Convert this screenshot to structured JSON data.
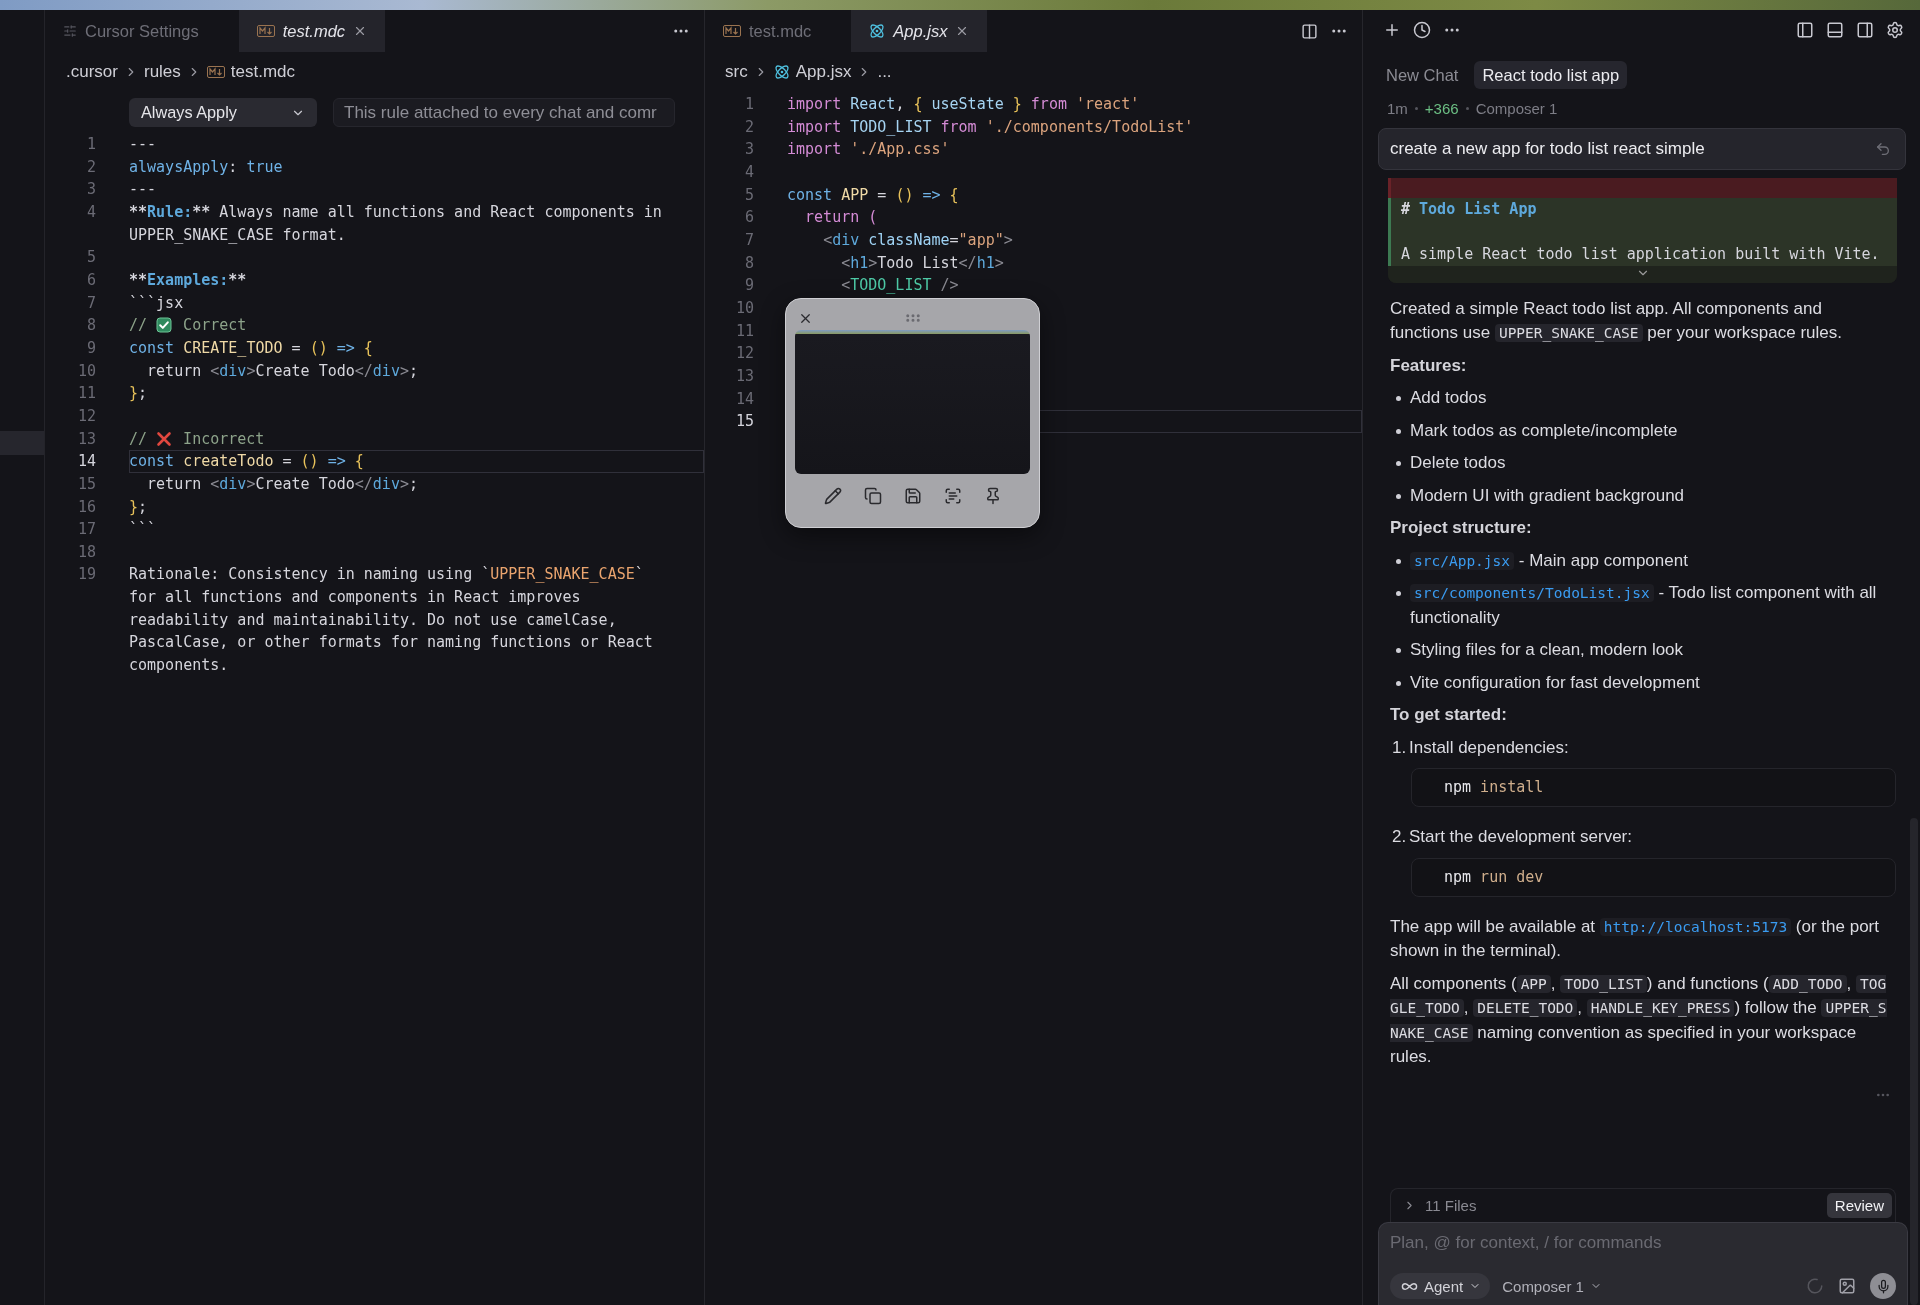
{
  "left_editor": {
    "tabs": [
      {
        "label": "Cursor Settings",
        "kind": "settings",
        "selected": false,
        "preview": false
      },
      {
        "label": "test.mdc",
        "kind": "markdown",
        "selected": true,
        "preview": true
      }
    ],
    "breadcrumb": [
      {
        "kind": "plain",
        "label": ".cursor"
      },
      {
        "kind": "plain",
        "label": "rules"
      },
      {
        "kind": "markdown",
        "label": "test.mdc"
      }
    ],
    "rule_type": {
      "value": "Always Apply"
    },
    "description": {
      "value": "This rule attached to every chat and comr"
    },
    "lines": [
      {
        "number": "1",
        "current": false,
        "tokens": [
          {
            "kind": "plain",
            "text": "---"
          }
        ]
      },
      {
        "number": "2",
        "current": false,
        "tokens": [
          {
            "kind": "key",
            "text": "alwaysApply"
          },
          {
            "kind": "plain",
            "text": ": "
          },
          {
            "kind": "key",
            "text": "true"
          }
        ]
      },
      {
        "number": "3",
        "current": false,
        "tokens": [
          {
            "kind": "plain",
            "text": "---"
          }
        ]
      },
      {
        "number": "4",
        "current": false,
        "tokens": [
          {
            "kind": "strong",
            "text": "**"
          },
          {
            "kind": "heading",
            "text": "Rule:"
          },
          {
            "kind": "strong",
            "text": "**"
          },
          {
            "kind": "plain",
            "text": " Always name all functions and React components in UPPER_SNAKE_CASE format."
          }
        ]
      },
      {
        "number": "5",
        "current": false
      },
      {
        "number": "6",
        "current": false,
        "tokens": [
          {
            "kind": "strong",
            "text": "**"
          },
          {
            "kind": "heading",
            "text": "Examples:"
          },
          {
            "kind": "strong",
            "text": "**"
          }
        ]
      },
      {
        "number": "7",
        "current": false,
        "tokens": [
          {
            "kind": "plain",
            "text": "```jsx"
          }
        ]
      },
      {
        "number": "8",
        "current": false,
        "tokens": [
          {
            "kind": "comment",
            "text": "// "
          },
          {
            "kind": "check-emoji"
          },
          {
            "kind": "comment",
            "text": " Correct"
          }
        ]
      },
      {
        "number": "9",
        "current": false,
        "tokens": [
          {
            "kind": "keyword",
            "text": "const"
          },
          {
            "kind": "function",
            "text": " CREATE_TODO"
          },
          {
            "kind": "plain",
            "text": " = "
          },
          {
            "kind": "bracket",
            "text": "()"
          },
          {
            "kind": "operator",
            "text": " =>"
          },
          {
            "kind": "bracket",
            "text": " {"
          }
        ]
      },
      {
        "number": "10",
        "current": false,
        "tokens": [
          {
            "kind": "plain",
            "text": "  return "
          },
          {
            "kind": "tagpunct",
            "text": "<"
          },
          {
            "kind": "tag",
            "text": "div"
          },
          {
            "kind": "tagpunct",
            "text": ">"
          },
          {
            "kind": "plain",
            "text": "Create Todo"
          },
          {
            "kind": "tagpunct",
            "text": "</"
          },
          {
            "kind": "tag",
            "text": "div"
          },
          {
            "kind": "tagpunct",
            "text": ">"
          },
          {
            "kind": "plain",
            "text": ";"
          }
        ]
      },
      {
        "number": "11",
        "current": false,
        "tokens": [
          {
            "kind": "bracket",
            "text": "}"
          },
          {
            "kind": "plain",
            "text": ";"
          }
        ]
      },
      {
        "number": "12",
        "current": false
      },
      {
        "number": "13",
        "current": false,
        "tokens": [
          {
            "kind": "comment",
            "text": "// "
          },
          {
            "kind": "cross-emoji"
          },
          {
            "kind": "comment",
            "text": " Incorrect"
          }
        ]
      },
      {
        "number": "14",
        "current": true,
        "tokens": [
          {
            "kind": "keyword",
            "text": "const"
          },
          {
            "kind": "function",
            "text": " createTodo"
          },
          {
            "kind": "plain",
            "text": " = "
          },
          {
            "kind": "bracket",
            "text": "()"
          },
          {
            "kind": "operator",
            "text": " =>"
          },
          {
            "kind": "bracket",
            "text": " {"
          }
        ]
      },
      {
        "number": "15",
        "current": false,
        "tokens": [
          {
            "kind": "plain",
            "text": "  return "
          },
          {
            "kind": "tagpunct",
            "text": "<"
          },
          {
            "kind": "tag",
            "text": "div"
          },
          {
            "kind": "tagpunct",
            "text": ">"
          },
          {
            "kind": "plain",
            "text": "Create Todo"
          },
          {
            "kind": "tagpunct",
            "text": "</"
          },
          {
            "kind": "tag",
            "text": "div"
          },
          {
            "kind": "tagpunct",
            "text": ">"
          },
          {
            "kind": "plain",
            "text": ";"
          }
        ]
      },
      {
        "number": "16",
        "current": false,
        "tokens": [
          {
            "kind": "bracket",
            "text": "}"
          },
          {
            "kind": "plain",
            "text": ";"
          }
        ]
      },
      {
        "number": "17",
        "current": false,
        "tokens": [
          {
            "kind": "plain",
            "text": "```"
          }
        ]
      },
      {
        "number": "18",
        "current": false
      },
      {
        "number": "19",
        "current": false,
        "tokens": [
          {
            "kind": "plain",
            "text": "Rationale: Consistency in naming using `"
          },
          {
            "kind": "codespan",
            "text": "UPPER_SNAKE_CASE"
          },
          {
            "kind": "plain",
            "text": "` for all functions and components in React improves readability and maintainability. Do not use camelCase, PascalCase, or other formats for naming functions or React components."
          }
        ]
      }
    ]
  },
  "middle_editor": {
    "tabs": [
      {
        "label": "test.mdc",
        "kind": "markdown",
        "selected": false,
        "preview": false
      },
      {
        "label": "App.jsx",
        "kind": "react",
        "selected": true,
        "preview": true
      }
    ],
    "breadcrumb": [
      {
        "kind": "plain",
        "label": "src"
      },
      {
        "kind": "react",
        "label": "App.jsx"
      },
      {
        "kind": "plain",
        "label": "..."
      }
    ],
    "lines": [
      {
        "number": "1",
        "current": false,
        "tokens": [
          {
            "kind": "control",
            "text": "import"
          },
          {
            "kind": "variable",
            "text": " React"
          },
          {
            "kind": "plain",
            "text": ", "
          },
          {
            "kind": "bracket",
            "text": "{"
          },
          {
            "kind": "variable",
            "text": " useState"
          },
          {
            "kind": "bracket",
            "text": " }"
          },
          {
            "kind": "control",
            "text": " from"
          },
          {
            "kind": "string",
            "text": " 'react'"
          }
        ]
      },
      {
        "number": "2",
        "current": false,
        "tokens": [
          {
            "kind": "control",
            "text": "import"
          },
          {
            "kind": "variable",
            "text": " TODO_LIST"
          },
          {
            "kind": "control",
            "text": " from"
          },
          {
            "kind": "string",
            "text": " './components/TodoList'"
          }
        ]
      },
      {
        "number": "3",
        "current": false,
        "tokens": [
          {
            "kind": "control",
            "text": "import"
          },
          {
            "kind": "string",
            "text": " './App.css'"
          }
        ]
      },
      {
        "number": "4",
        "current": false
      },
      {
        "number": "5",
        "current": false,
        "tokens": [
          {
            "kind": "keyword",
            "text": "const"
          },
          {
            "kind": "function",
            "text": " APP"
          },
          {
            "kind": "plain",
            "text": " = "
          },
          {
            "kind": "bracket",
            "text": "()"
          },
          {
            "kind": "operator",
            "text": " =>"
          },
          {
            "kind": "bracket",
            "text": " {"
          }
        ]
      },
      {
        "number": "6",
        "current": false,
        "tokens": [
          {
            "kind": "control",
            "text": "  return"
          },
          {
            "kind": "control",
            "text": " ("
          }
        ]
      },
      {
        "number": "7",
        "current": false,
        "tokens": [
          {
            "kind": "tagpunct",
            "text": "    <"
          },
          {
            "kind": "tag",
            "text": "div"
          },
          {
            "kind": "attr",
            "text": " className"
          },
          {
            "kind": "plain",
            "text": "="
          },
          {
            "kind": "string",
            "text": "\"app\""
          },
          {
            "kind": "tagpunct",
            "text": ">"
          }
        ]
      },
      {
        "number": "8",
        "current": false,
        "tokens": [
          {
            "kind": "tagpunct",
            "text": "      <"
          },
          {
            "kind": "tag",
            "text": "h1"
          },
          {
            "kind": "tagpunct",
            "text": ">"
          },
          {
            "kind": "plain",
            "text": "Todo List"
          },
          {
            "kind": "tagpunct",
            "text": "</"
          },
          {
            "kind": "tag",
            "text": "h1"
          },
          {
            "kind": "tagpunct",
            "text": ">"
          }
        ]
      },
      {
        "number": "9",
        "current": false,
        "tokens": [
          {
            "kind": "tagpunct",
            "text": "      <"
          },
          {
            "kind": "component",
            "text": "TODO_LIST"
          },
          {
            "kind": "tagpunct",
            "text": " />"
          }
        ]
      },
      {
        "number": "10",
        "current": false
      },
      {
        "number": "11",
        "current": false
      },
      {
        "number": "12",
        "current": false
      },
      {
        "number": "13",
        "current": false
      },
      {
        "number": "14",
        "current": false
      },
      {
        "number": "15",
        "current": true
      }
    ]
  },
  "chat": {
    "tabs": [
      {
        "label": "New Chat",
        "selected": false
      },
      {
        "label": "React todo list app",
        "selected": true
      }
    ],
    "meta": [
      {
        "kind": "age",
        "text": "1m"
      },
      {
        "kind": "additions",
        "text": "+366"
      },
      {
        "kind": "model",
        "text": "Composer 1"
      }
    ],
    "prompt": "create a new app for todo list react simple",
    "diff": {
      "expanded": false,
      "lines": [
        {
          "kind": "removed"
        },
        {
          "kind": "added",
          "tokens": [
            {
              "kind": "marker",
              "text": "# "
            },
            {
              "kind": "heading",
              "text": "Todo List App"
            }
          ]
        },
        {
          "kind": "added"
        },
        {
          "kind": "added",
          "tokens": [
            {
              "kind": "plain",
              "text": "A simple React todo list application built with Vite."
            }
          ]
        }
      ]
    },
    "response": [
      {
        "kind": "paragraph",
        "parts": [
          {
            "kind": "text",
            "text": "Created a simple React todo list app. All components and functions use "
          },
          {
            "kind": "code",
            "text": "UPPER_SNAKE_CASE"
          },
          {
            "kind": "text",
            "text": " per your workspace rules."
          }
        ]
      },
      {
        "kind": "heading",
        "text": "Features:"
      },
      {
        "kind": "bullets",
        "items": [
          {
            "parts": [
              {
                "kind": "text",
                "text": "Add todos"
              }
            ]
          },
          {
            "parts": [
              {
                "kind": "text",
                "text": "Mark todos as complete/incomplete"
              }
            ]
          },
          {
            "parts": [
              {
                "kind": "text",
                "text": "Delete todos"
              }
            ]
          },
          {
            "parts": [
              {
                "kind": "text",
                "text": "Modern UI with gradient background"
              }
            ]
          }
        ]
      },
      {
        "kind": "heading",
        "text": "Project structure:"
      },
      {
        "kind": "bullets",
        "items": [
          {
            "parts": [
              {
                "kind": "link",
                "text": "src/App.jsx"
              },
              {
                "kind": "text",
                "text": " - Main app component"
              }
            ]
          },
          {
            "parts": [
              {
                "kind": "link",
                "text": "src/components/TodoList.jsx"
              },
              {
                "kind": "text",
                "text": " - Todo list component with all functionality"
              }
            ]
          },
          {
            "parts": [
              {
                "kind": "text",
                "text": "Styling files for a clean, modern look"
              }
            ]
          },
          {
            "parts": [
              {
                "kind": "text",
                "text": "Vite configuration for fast development"
              }
            ]
          }
        ]
      },
      {
        "kind": "heading",
        "text": "To get started:"
      },
      {
        "kind": "step",
        "number": "1.",
        "text": "Install dependencies:",
        "command": [
          {
            "kind": "command",
            "text": "npm"
          },
          {
            "kind": "arg",
            "text": " install"
          }
        ]
      },
      {
        "kind": "step",
        "number": "2.",
        "text": "Start the development server:",
        "command": [
          {
            "kind": "command",
            "text": "npm"
          },
          {
            "kind": "arg",
            "text": " run dev"
          }
        ]
      },
      {
        "kind": "paragraph",
        "parts": [
          {
            "kind": "text",
            "text": "The app will be available at "
          },
          {
            "kind": "url",
            "text": "http://localhost:5173"
          },
          {
            "kind": "text",
            "text": " (or the port shown in the terminal)."
          }
        ]
      },
      {
        "kind": "paragraph",
        "parts": [
          {
            "kind": "text",
            "text": "All components ("
          },
          {
            "kind": "code",
            "text": "APP"
          },
          {
            "kind": "text",
            "text": ", "
          },
          {
            "kind": "code",
            "text": "TODO_LIST"
          },
          {
            "kind": "text",
            "text": ") and functions ("
          },
          {
            "kind": "code",
            "text": "ADD_TODO"
          },
          {
            "kind": "text",
            "text": ", "
          },
          {
            "kind": "code",
            "text": "TOGGLE_TODO"
          },
          {
            "kind": "text",
            "text": ", "
          },
          {
            "kind": "code",
            "text": "DELETE_TODO"
          },
          {
            "kind": "text",
            "text": ", "
          },
          {
            "kind": "code",
            "text": "HANDLE_KEY_PRESS"
          },
          {
            "kind": "text",
            "text": ") follow the "
          },
          {
            "kind": "code",
            "text": "UPPER_SNAKE_CASE"
          },
          {
            "kind": "text",
            "text": " naming convention as specified in your workspace rules."
          }
        ]
      }
    ],
    "files": {
      "label": "11 Files",
      "expanded": false
    },
    "review_button": "Review",
    "composer": {
      "placeholder": "Plan, @ for context, / for commands",
      "mode": "Agent",
      "model": "Composer 1"
    }
  }
}
